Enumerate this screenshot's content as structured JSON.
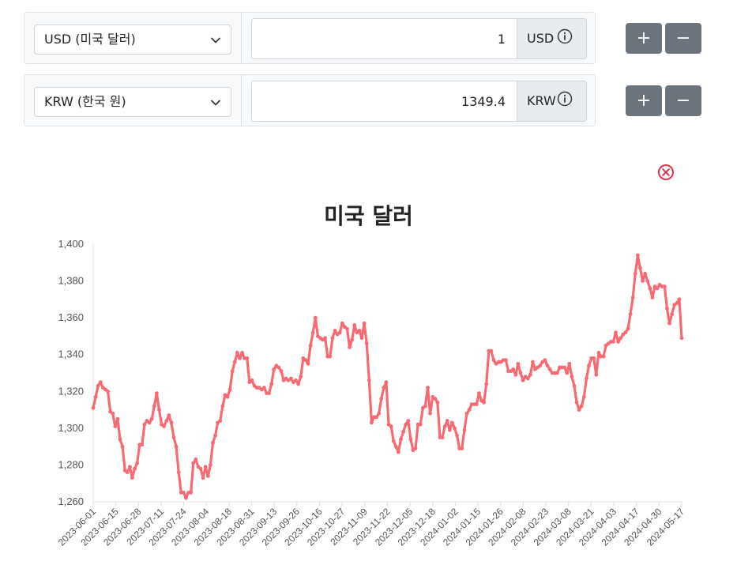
{
  "converter": {
    "rows": [
      {
        "currency_label": "USD (미국 달러)",
        "amount": "1",
        "unit": "USD"
      },
      {
        "currency_label": "KRW (한국 원)",
        "amount": "1349.4",
        "unit": "KRW"
      }
    ],
    "plus_label": "+",
    "minus_label": "−"
  },
  "colors": {
    "line": "#f76a73",
    "button": "#6c757d",
    "close": "#dc3545"
  },
  "chart_data": {
    "type": "line",
    "title": "미국 달러",
    "xlabel": "",
    "ylabel": "",
    "ylim": [
      1260,
      1400
    ],
    "yticks": [
      1260,
      1280,
      1300,
      1320,
      1340,
      1360,
      1380,
      1400
    ],
    "ytick_labels": [
      "1,260",
      "1,280",
      "1,300",
      "1,320",
      "1,340",
      "1,360",
      "1,380",
      "1,400"
    ],
    "xtick_labels": [
      "2023-06-01",
      "2023-06-15",
      "2023-06-28",
      "2023-07-11",
      "2023-07-24",
      "2023-08-04",
      "2023-08-18",
      "2023-08-31",
      "2023-09-13",
      "2023-09-26",
      "2023-10-16",
      "2023-10-27",
      "2023-11-09",
      "2023-11-22",
      "2023-12-05",
      "2023-12-18",
      "2024-01-02",
      "2024-01-15",
      "2024-01-26",
      "2024-02-08",
      "2024-02-23",
      "2024-03-08",
      "2024-03-21",
      "2024-04-03",
      "2024-04-17",
      "2024-04-30",
      "2024-05-17"
    ],
    "grid": false,
    "legend": "none",
    "series": [
      {
        "values": [
          1311,
          1317,
          1323,
          1325,
          1322,
          1321,
          1320,
          1309,
          1308,
          1301,
          1305,
          1294,
          1290,
          1277,
          1276,
          1279,
          1273,
          1278,
          1281,
          1291,
          1291,
          1302,
          1304,
          1303,
          1305,
          1312,
          1319,
          1310,
          1302,
          1301,
          1304,
          1307,
          1303,
          1295,
          1290,
          1276,
          1265,
          1265,
          1262,
          1265,
          1265,
          1281,
          1283,
          1279,
          1278,
          1273,
          1279,
          1274,
          1280,
          1292,
          1296,
          1303,
          1304,
          1312,
          1318,
          1317,
          1321,
          1331,
          1336,
          1341,
          1338,
          1341,
          1338,
          1338,
          1325,
          1326,
          1323,
          1322,
          1322,
          1321,
          1322,
          1319,
          1319,
          1324,
          1332,
          1334,
          1333,
          1331,
          1326,
          1327,
          1326,
          1327,
          1325,
          1326,
          1324,
          1328,
          1338,
          1337,
          1335,
          1345,
          1352,
          1360,
          1350,
          1349,
          1348,
          1349,
          1339,
          1339,
          1349,
          1353,
          1351,
          1352,
          1357,
          1355,
          1354,
          1344,
          1348,
          1356,
          1352,
          1353,
          1349,
          1357,
          1346,
          1326,
          1303,
          1306,
          1306,
          1308,
          1316,
          1322,
          1325,
          1302,
          1301,
          1293,
          1290,
          1287,
          1294,
          1298,
          1302,
          1304,
          1294,
          1288,
          1289,
          1302,
          1302,
          1311,
          1312,
          1322,
          1308,
          1317,
          1316,
          1314,
          1295,
          1295,
          1301,
          1304,
          1299,
          1303,
          1300,
          1296,
          1289,
          1289,
          1299,
          1308,
          1310,
          1313,
          1313,
          1313,
          1319,
          1315,
          1314,
          1324,
          1342,
          1342,
          1337,
          1335,
          1336,
          1336,
          1337,
          1337,
          1331,
          1331,
          1332,
          1329,
          1335,
          1330,
          1326,
          1328,
          1327,
          1329,
          1336,
          1332,
          1333,
          1334,
          1336,
          1337,
          1334,
          1332,
          1330,
          1330,
          1330,
          1333,
          1333,
          1333,
          1330,
          1335,
          1328,
          1323,
          1314,
          1310,
          1312,
          1317,
          1327,
          1334,
          1338,
          1338,
          1329,
          1341,
          1339,
          1339,
          1345,
          1346,
          1347,
          1347,
          1352,
          1347,
          1349,
          1351,
          1352,
          1354,
          1362,
          1371,
          1384,
          1394,
          1387,
          1380,
          1384,
          1380,
          1376,
          1371,
          1377,
          1376,
          1378,
          1377,
          1377,
          1365,
          1357,
          1362,
          1367,
          1368,
          1370,
          1349
        ]
      }
    ]
  }
}
